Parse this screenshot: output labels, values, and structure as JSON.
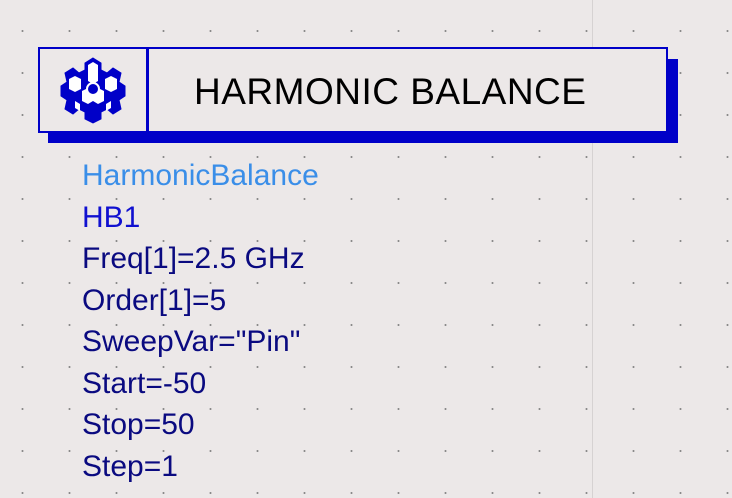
{
  "component": {
    "banner_title": "HARMONIC BALANCE",
    "icon": "harmonic-balance-gear-icon",
    "type": "HarmonicBalance",
    "instance_name": "HB1",
    "parameters": [
      "Freq[1]=2.5 GHz",
      "Order[1]=5",
      "SweepVar=\"Pin\"",
      "Start=-50",
      "Stop=50",
      "Step=1"
    ]
  },
  "colors": {
    "frame": "#0000c8",
    "type_text": "#3a8ee8",
    "instance_text": "#1010d0",
    "param_text": "#0a0a80",
    "canvas": "#ece8e8"
  }
}
